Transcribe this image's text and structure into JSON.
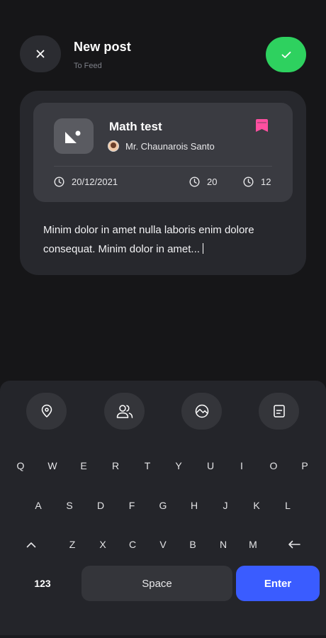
{
  "header": {
    "title": "New post",
    "subtitle": "To Feed",
    "close_icon": "close-icon",
    "confirm_icon": "check-icon",
    "confirm_color": "#2ed15f"
  },
  "post": {
    "title": "Math test",
    "author": "Mr. Chaunarois Santo",
    "date": "20/12/2021",
    "meta_1": "20",
    "meta_2": "12",
    "bookmark_color": "#ff4fa0",
    "body": "Minim dolor in amet nulla laboris enim dolore consequat. Minim dolor in amet..."
  },
  "toolbar": {
    "icons": [
      "location-pin-icon",
      "people-icon",
      "image-icon",
      "document-icon"
    ]
  },
  "keyboard": {
    "row1": [
      "Q",
      "W",
      "E",
      "R",
      "T",
      "Y",
      "U",
      "I",
      "O",
      "P"
    ],
    "row2": [
      "A",
      "S",
      "D",
      "F",
      "G",
      "H",
      "J",
      "K",
      "L"
    ],
    "row3": [
      "Z",
      "X",
      "C",
      "V",
      "B",
      "N",
      "M"
    ],
    "numbers_label": "123",
    "space_label": "Space",
    "enter_label": "Enter",
    "enter_color": "#3a5cff"
  }
}
